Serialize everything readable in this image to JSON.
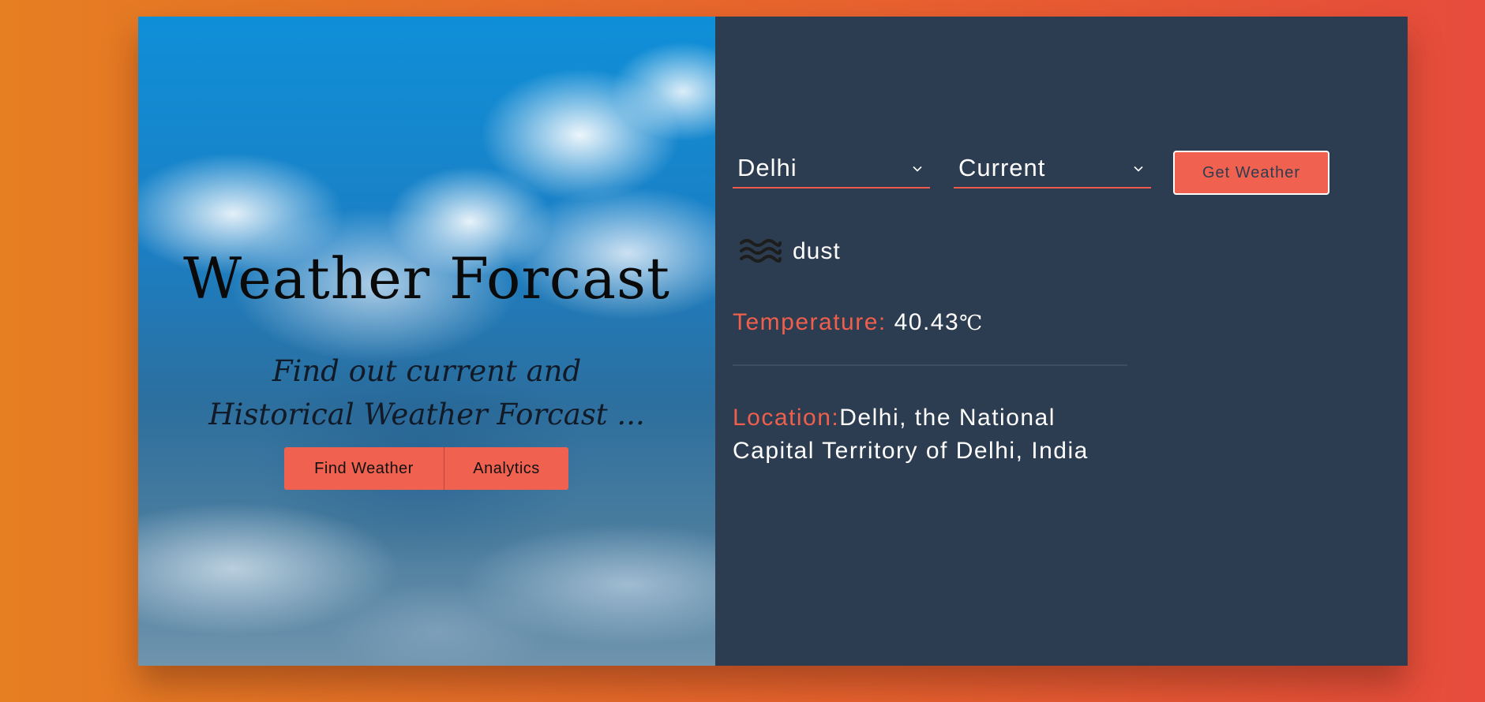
{
  "hero": {
    "title": "Weather Forcast",
    "subtitle": "Find out current and Historical Weather Forcast ...",
    "find_button": "Find Weather",
    "analytics_button": "Analytics"
  },
  "controls": {
    "city": "Delhi",
    "mode": "Current",
    "get_button": "Get Weather"
  },
  "result": {
    "condition_icon": "dust-icon",
    "condition": "dust",
    "temperature_label": "Temperature:",
    "temperature_value": "40.43",
    "temperature_unit": "℃",
    "location_label": "Location:",
    "location_value": "Delhi, the National Capital Territory of Delhi, India"
  },
  "colors": {
    "accent": "#ef5f4c",
    "panel": "#2d3d51"
  }
}
